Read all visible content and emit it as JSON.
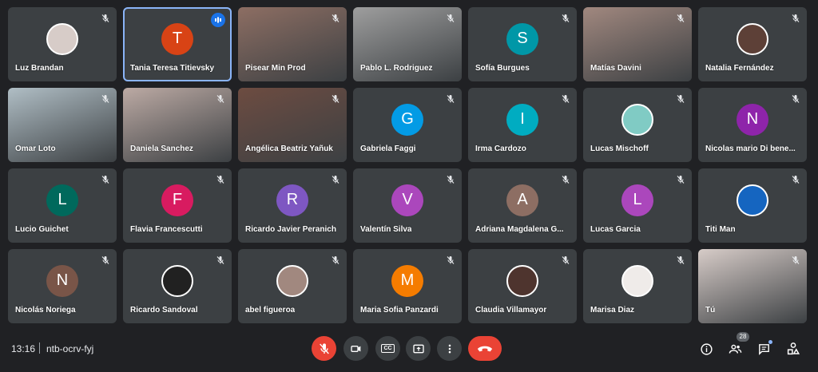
{
  "meeting": {
    "time": "13:16",
    "code": "ntb-ocrv-fyj",
    "participants_count": "28"
  },
  "colors": {
    "background": "#202124",
    "tile": "#3c4043",
    "speaking_outline": "#8ab4f8",
    "hangup_red": "#ea4335"
  },
  "participants": [
    {
      "name": "Luz Brandan",
      "type": "photo",
      "color": "#d7ccc8"
    },
    {
      "name": "Tania Teresa Titievsky",
      "type": "initial",
      "initial": "T",
      "color": "#d84315",
      "speaking": true
    },
    {
      "name": "Pisear Min Prod",
      "type": "video",
      "color": "#8d6e63"
    },
    {
      "name": "Pablo L. Rodriguez",
      "type": "video",
      "color": "#9e9e9e"
    },
    {
      "name": "Sofía Burgues",
      "type": "initial",
      "initial": "S",
      "color": "#0097a7"
    },
    {
      "name": "Matías Davini",
      "type": "video",
      "color": "#a1887f"
    },
    {
      "name": "Natalia Fernández",
      "type": "photo",
      "color": "#5d4037"
    },
    {
      "name": "Omar Loto",
      "type": "video",
      "color": "#b0bec5"
    },
    {
      "name": "Daniela Sanchez",
      "type": "video",
      "color": "#bcaaa4"
    },
    {
      "name": "Angélica Beatriz Yañuk",
      "type": "video",
      "color": "#6d4c41"
    },
    {
      "name": "Gabriela Faggi",
      "type": "initial",
      "initial": "G",
      "color": "#039be5"
    },
    {
      "name": "Irma Cardozo",
      "type": "initial",
      "initial": "I",
      "color": "#00acc1"
    },
    {
      "name": "Lucas Mischoff",
      "type": "photo",
      "color": "#80cbc4"
    },
    {
      "name": "Nicolas mario Di bene...",
      "type": "initial",
      "initial": "N",
      "color": "#8e24aa"
    },
    {
      "name": "Lucio Guichet",
      "type": "initial",
      "initial": "L",
      "color": "#00695c"
    },
    {
      "name": "Flavia Francescutti",
      "type": "initial",
      "initial": "F",
      "color": "#d81b60"
    },
    {
      "name": "Ricardo Javier Peranich",
      "type": "initial",
      "initial": "R",
      "color": "#7e57c2"
    },
    {
      "name": "Valentín Silva",
      "type": "initial",
      "initial": "V",
      "color": "#ab47bc"
    },
    {
      "name": "Adriana Magdalena G...",
      "type": "initial",
      "initial": "A",
      "color": "#8d6e63"
    },
    {
      "name": "Lucas Garcia",
      "type": "initial",
      "initial": "L",
      "color": "#ab47bc"
    },
    {
      "name": "Titi Man",
      "type": "photo",
      "color": "#1565c0"
    },
    {
      "name": "Nicolás Noriega",
      "type": "initial",
      "initial": "N",
      "color": "#795548"
    },
    {
      "name": "Ricardo Sandoval",
      "type": "photo",
      "color": "#212121"
    },
    {
      "name": "abel figueroa",
      "type": "photo",
      "color": "#a1887f"
    },
    {
      "name": "Maria Sofia Panzardi",
      "type": "initial",
      "initial": "M",
      "color": "#f57c00"
    },
    {
      "name": "Claudia Villamayor",
      "type": "photo",
      "color": "#4e342e"
    },
    {
      "name": "Marisa Diaz",
      "type": "photo",
      "color": "#efebe9"
    },
    {
      "name": "Tú",
      "type": "video",
      "color": "#d7ccc8"
    }
  ],
  "controls": {
    "mic": "mic-off-icon",
    "camera": "camera-icon",
    "captions_label": "CC",
    "present": "present-icon",
    "more": "more-vert-icon",
    "hangup": "hangup-icon"
  },
  "right_controls": [
    "info-icon",
    "people-icon",
    "chat-icon",
    "activities-icon"
  ]
}
